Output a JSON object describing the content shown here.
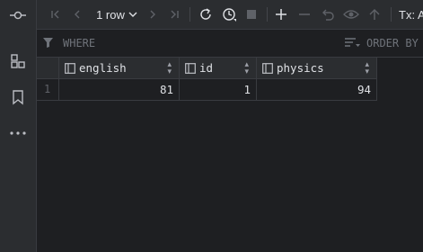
{
  "toolbar": {
    "rows_label": "1 row",
    "tx_label": "Tx: A"
  },
  "filter": {
    "where_label": "WHERE",
    "order_label": "ORDER BY"
  },
  "table": {
    "columns": [
      "english",
      "id",
      "physics"
    ],
    "rows": [
      {
        "num": "1",
        "cells": [
          "81",
          "1",
          "94"
        ]
      }
    ]
  }
}
